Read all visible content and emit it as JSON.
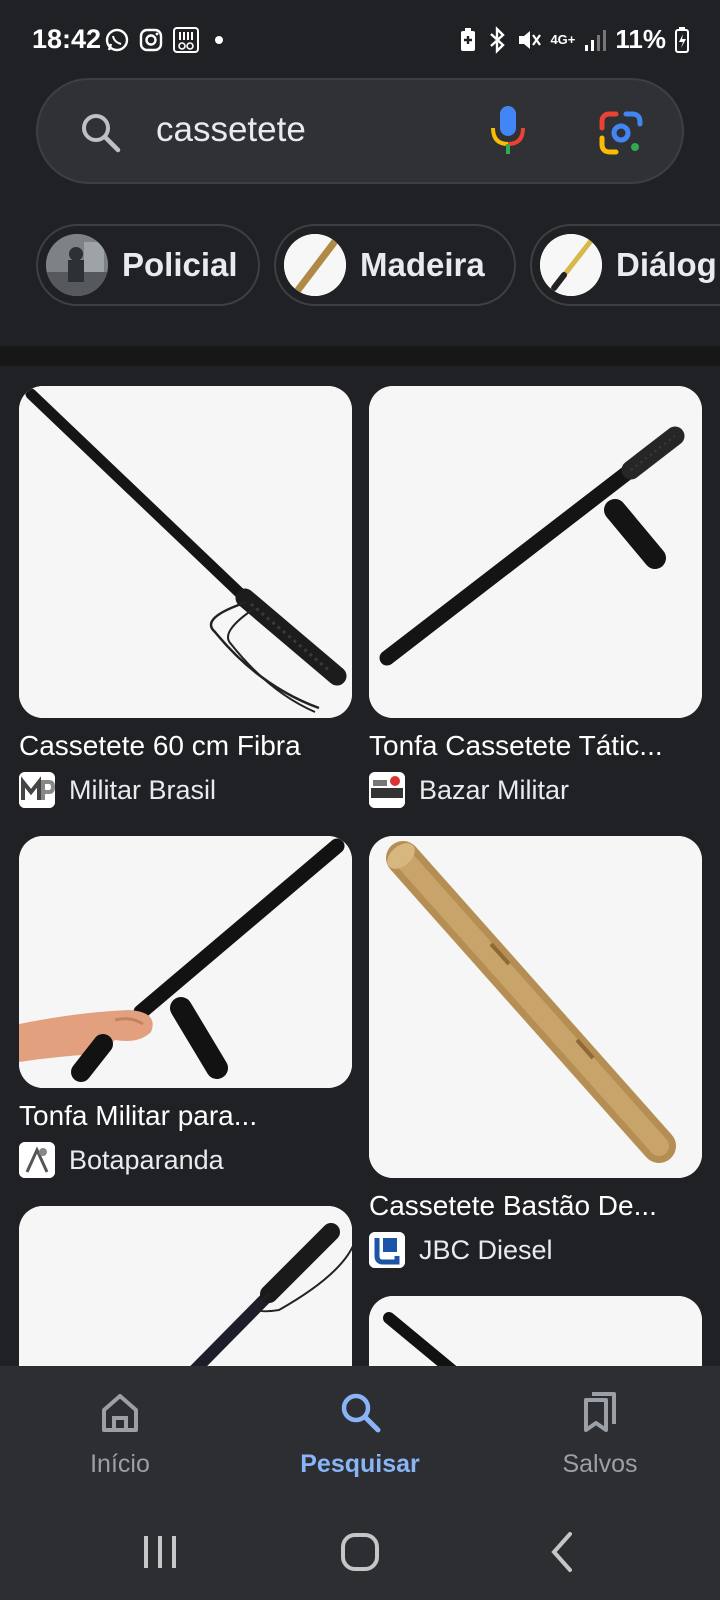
{
  "status_bar": {
    "time": "18:42",
    "battery": "11%",
    "network": "4G+",
    "left_icons": [
      "whatsapp-icon",
      "instagram-icon",
      "equalizer-app-icon",
      "notification-dot-icon"
    ],
    "right_icons": [
      "battery-saver-icon",
      "bluetooth-icon",
      "mute-icon",
      "network-icon",
      "signal-icon",
      "battery-charging-icon"
    ]
  },
  "search": {
    "query": "cassetete",
    "icons": [
      "search-icon",
      "mic-icon",
      "lens-icon"
    ]
  },
  "chips": [
    {
      "label": "Policial"
    },
    {
      "label": "Madeira"
    },
    {
      "label": "Diálog"
    }
  ],
  "results": [
    {
      "title": "Cassetete 60 cm Fibra",
      "source": "Militar Brasil"
    },
    {
      "title": "Tonfa Cassetete Tátic...",
      "source": "Bazar Militar"
    },
    {
      "title": "Tonfa Militar para...",
      "source": "Botaparanda"
    },
    {
      "title": "Cassetete Bastão De...",
      "source": "JBC Diesel"
    }
  ],
  "bottom_nav": {
    "items": [
      {
        "label": "Início",
        "icon": "home-icon",
        "active": false
      },
      {
        "label": "Pesquisar",
        "icon": "search-icon",
        "active": true
      },
      {
        "label": "Salvos",
        "icon": "bookmarks-icon",
        "active": false
      }
    ]
  },
  "system_nav": [
    "recents-icon",
    "home-icon",
    "back-icon"
  ],
  "colors": {
    "background": "#202124",
    "surface": "#303134",
    "accent": "#8ab4f8",
    "text": "#e8eaed",
    "muted": "#9aa0a6"
  }
}
